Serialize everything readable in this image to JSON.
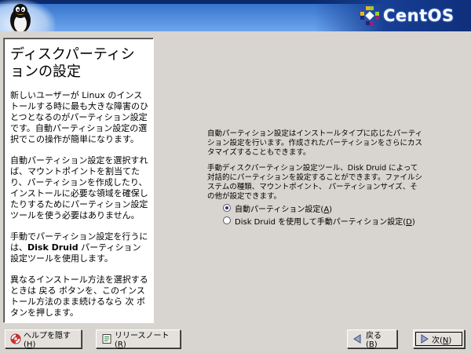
{
  "header": {
    "brand": "CentOS"
  },
  "help": {
    "title": "ディスクパーティションの設定",
    "p1": "新しいユーザーが Linux のインストールする時に最も大きな障害のひとつとなるのがパーティション設定です。自動パーティション設定の選択でこの操作が簡単になります。",
    "p2": "自動パーティション設定を選択すれば、マウントポイントを割当てたり、パーティションを作成したり、インストールに必要な領域を確保したりするためにパーティション設定ツールを使う必要はありません。",
    "p3_pre": "手動でパーティション設定を行うには、",
    "p3_bold": "Disk Druid",
    "p3_post": " パーティション設定ツールを使用します。",
    "p4": "異なるインストール方法を選択するときは 戻る ボタンを、このインストール方法のまま続けるなら 次 ボタンを押します。"
  },
  "main": {
    "para1": "自動パーティション設定はインストールタイプに応じたパーティション設定を行います。作成されたパーティションをさらにカスタマイズすることもできます。",
    "para2": "手動ディスクパーティション設定ツール、Disk Druid によって対話的にパーティションを設定することができます。ファイルシステムの種類、マウントポイント、 パーティションサイズ、その他が設定できます。",
    "options": [
      {
        "label_pre": "自動パーティション設定(",
        "key": "A",
        "label_post": ")",
        "checked": true
      },
      {
        "label_pre": "Disk Druid を使用して手動パーティション設定(",
        "key": "D",
        "label_post": ")",
        "checked": false
      }
    ]
  },
  "buttons": {
    "hide_help": {
      "pre": "ヘルプを隠す(",
      "key": "H",
      "post": ")"
    },
    "release_notes": {
      "pre": "リリースノート(",
      "key": "R",
      "post": ")"
    },
    "back": {
      "pre": "戻る(",
      "key": "B",
      "post": ")"
    },
    "next": {
      "pre": "次(",
      "key": "N",
      "post": ")"
    }
  }
}
